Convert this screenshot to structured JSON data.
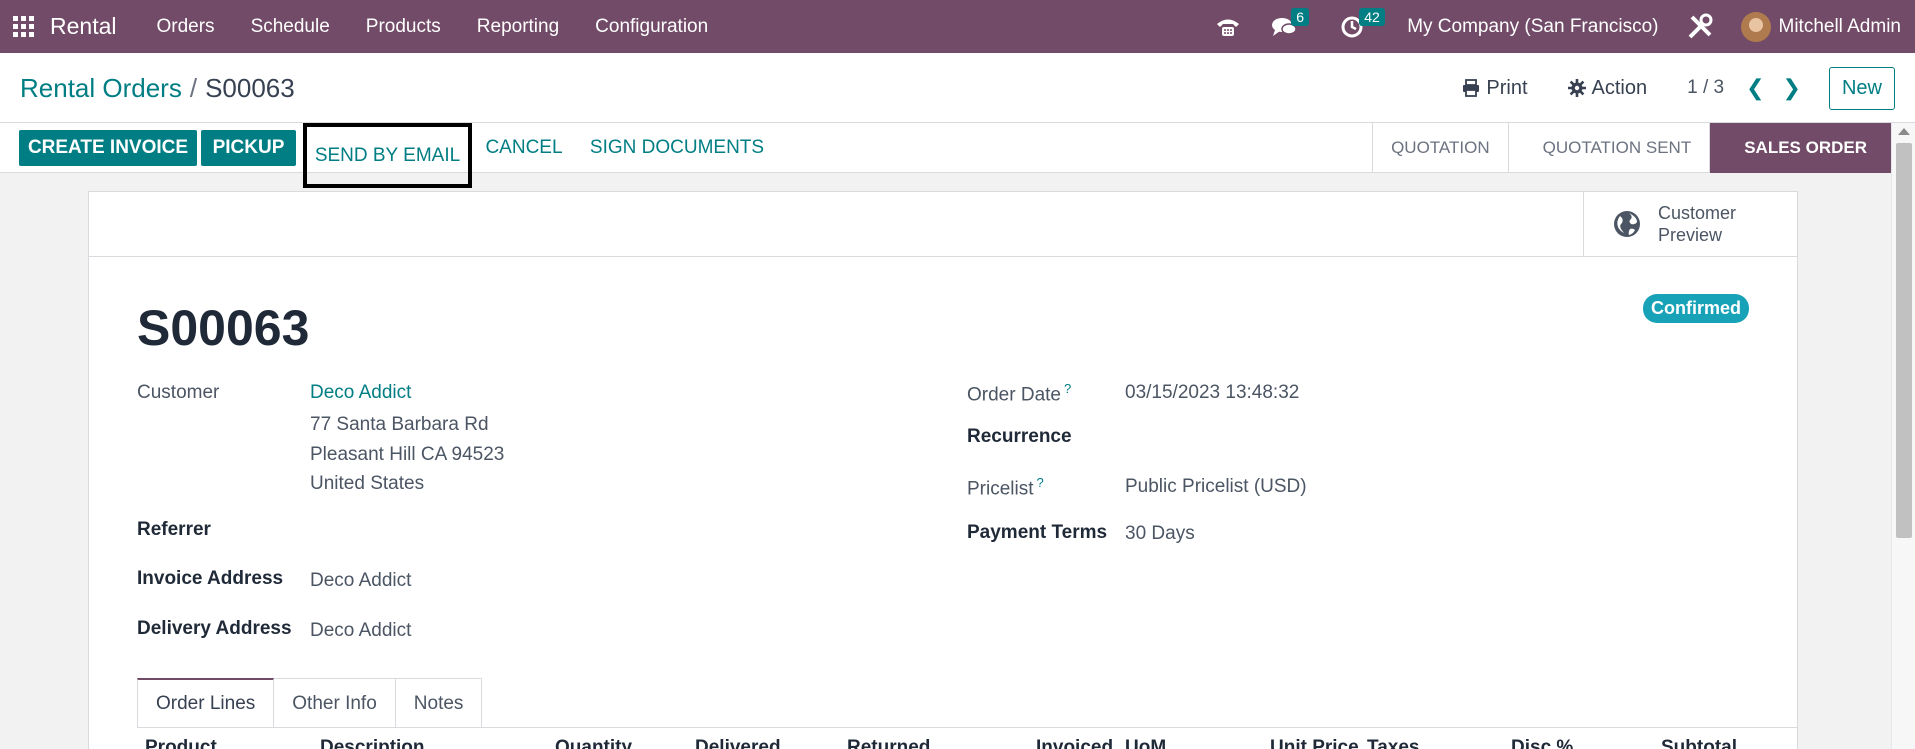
{
  "navbar": {
    "brand": "Rental",
    "menu": [
      "Orders",
      "Schedule",
      "Products",
      "Reporting",
      "Configuration"
    ],
    "messages_count": "6",
    "activities_count": "42",
    "company": "My Company (San Francisco)",
    "user": "Mitchell Admin"
  },
  "control": {
    "breadcrumb_parent": "Rental Orders",
    "breadcrumb_separator": "/",
    "breadcrumb_current": "S00063",
    "print_label": "Print",
    "action_label": "Action",
    "pager": "1 / 3",
    "new_label": "New"
  },
  "statusbar": {
    "buttons": [
      "CREATE INVOICE",
      "PICKUP",
      "SEND BY EMAIL",
      "CANCEL",
      "SIGN DOCUMENTS"
    ],
    "stages": [
      "QUOTATION",
      "QUOTATION SENT",
      "SALES ORDER"
    ],
    "active_stage": "SALES ORDER"
  },
  "form": {
    "preview_label": "Customer Preview",
    "order_name": "S00063",
    "status": "Confirmed",
    "customer_label": "Customer",
    "customer_name": "Deco Addict",
    "customer_address": [
      "77 Santa Barbara Rd",
      "Pleasant Hill CA 94523",
      "United States"
    ],
    "referrer_label": "Referrer",
    "invoice_address_label": "Invoice Address",
    "invoice_address": "Deco Addict",
    "delivery_address_label": "Delivery Address",
    "delivery_address": "Deco Addict",
    "order_date_label": "Order Date",
    "order_date": "03/15/2023 13:48:32",
    "recurrence_label": "Recurrence",
    "pricelist_label": "Pricelist",
    "pricelist": "Public Pricelist (USD)",
    "payment_terms_label": "Payment Terms",
    "payment_terms": "30 Days",
    "help_mark": "?"
  },
  "tabs": [
    "Order Lines",
    "Other Info",
    "Notes"
  ],
  "table_headers": [
    "Product",
    "Description",
    "Quantity",
    "Delivered",
    "Returned",
    "Invoiced",
    "UoM",
    "Unit Price",
    "Taxes",
    "Disc.%",
    "Subtotal"
  ],
  "colors": {
    "brand": "#714b67",
    "accent": "#017e84",
    "status": "#17a2b8"
  }
}
